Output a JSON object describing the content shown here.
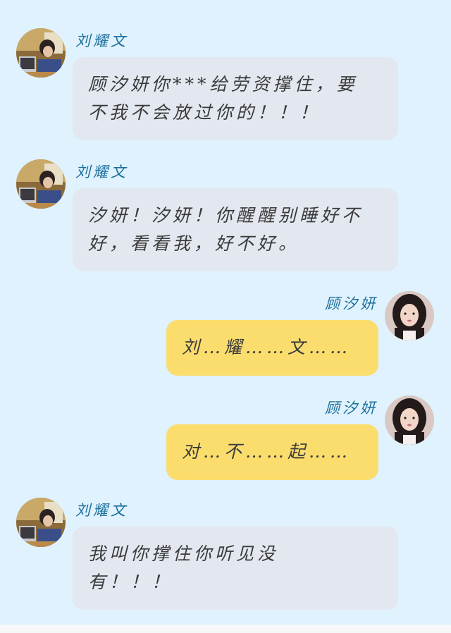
{
  "messages": [
    {
      "side": "left",
      "sender": "刘耀文",
      "text": "顾汐妍你***给劳资撑住，要不我不会放过你的！！！"
    },
    {
      "side": "left",
      "sender": "刘耀文",
      "text": "汐妍！汐妍！你醒醒别睡好不好，看看我，好不好。"
    },
    {
      "side": "right",
      "sender": "顾汐妍",
      "text": "刘…耀……文……"
    },
    {
      "side": "right",
      "sender": "顾汐妍",
      "text": "对…不……起……"
    },
    {
      "side": "left",
      "sender": "刘耀文",
      "text": "我叫你撑住你听见没有！！！"
    }
  ],
  "colors": {
    "background": "#dff2fe",
    "left_bubble": "#e3e7ef",
    "right_bubble": "#fbdd6e",
    "name": "#1d6f9c"
  }
}
